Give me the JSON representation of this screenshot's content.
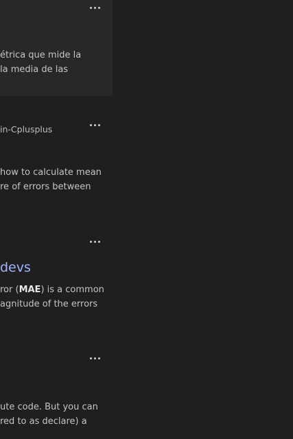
{
  "results": [
    {
      "more_label": "more options",
      "snippet": [
        "étrica que mide la",
        "la media de las"
      ]
    },
    {
      "more_label": "more options",
      "url": "in-Cplusplus",
      "snippet": [
        "how to calculate mean",
        "re of errors between"
      ]
    },
    {
      "more_label": "more options",
      "title": "devs",
      "snippet_a_pre": "ror (",
      "snippet_a_bold": "MAE",
      "snippet_a_post": ") is a common",
      "snippet_b": "agnitude of the errors"
    },
    {
      "more_label": "more options",
      "snippet": [
        "ute code. But you can",
        "red to as declare) a"
      ]
    }
  ]
}
